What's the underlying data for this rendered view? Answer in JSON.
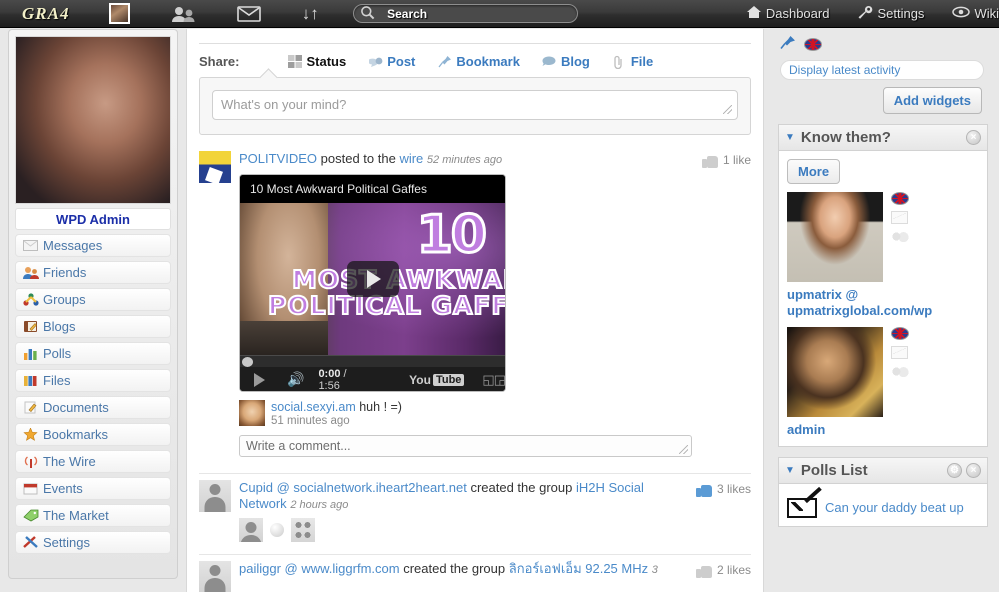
{
  "topbar": {
    "logo": "GRA4",
    "icons": [
      {
        "name": "user-avatar-icon",
        "label": "Profile"
      },
      {
        "name": "friends-icon",
        "label": "Friends"
      },
      {
        "name": "messages-icon",
        "label": "Messages"
      },
      {
        "name": "updates-icon",
        "label": "Updates"
      }
    ],
    "search": {
      "text": "Search",
      "placeholder": "Search"
    },
    "right_links": [
      {
        "name": "dashboard",
        "label": "Dashboard",
        "icon": "home-icon"
      },
      {
        "name": "settings",
        "label": "Settings",
        "icon": "wrench-icon"
      },
      {
        "name": "wiki",
        "label": "Wiki",
        "icon": "eye-icon"
      }
    ]
  },
  "sidebar": {
    "profile_name": "WPD Admin",
    "items": [
      {
        "label": "Messages",
        "icon": "envelope-icon"
      },
      {
        "label": "Friends",
        "icon": "friends-icon"
      },
      {
        "label": "Groups",
        "icon": "groups-icon"
      },
      {
        "label": "Blogs",
        "icon": "notebook-icon"
      },
      {
        "label": "Polls",
        "icon": "bar-chart-icon"
      },
      {
        "label": "Files",
        "icon": "folders-icon"
      },
      {
        "label": "Documents",
        "icon": "document-icon"
      },
      {
        "label": "Bookmarks",
        "icon": "star-icon"
      },
      {
        "label": "The Wire",
        "icon": "broadcast-icon"
      },
      {
        "label": "Events",
        "icon": "calendar-icon"
      },
      {
        "label": "The Market",
        "icon": "tag-icon"
      },
      {
        "label": "Settings",
        "icon": "tools-icon"
      }
    ]
  },
  "share": {
    "label": "Share:",
    "tabs": [
      {
        "label": "Status",
        "icon": "status-icon",
        "active": true
      },
      {
        "label": "Post",
        "icon": "post-icon",
        "active": false
      },
      {
        "label": "Bookmark",
        "icon": "pin-icon",
        "active": false
      },
      {
        "label": "Blog",
        "icon": "speech-bubble-icon",
        "active": false
      },
      {
        "label": "File",
        "icon": "paperclip-icon",
        "active": false
      }
    ],
    "input_placeholder": "What's on your mind?"
  },
  "feed": {
    "items": [
      {
        "author": "POLITVIDEO",
        "action": "posted to the",
        "target": "wire",
        "time": "52 minutes ago",
        "likes": "1 like",
        "like_color": "gray",
        "video": {
          "title": "10 Most Awkward Political Gaffes",
          "overlay_number": "10",
          "overlay_line1": "MOST AWKWARD",
          "overlay_line2": "POLITICAL GAFFES",
          "current_time": "0:00",
          "separator": "/",
          "duration": "1:56",
          "brand_you": "You",
          "brand_tube": "Tube"
        },
        "comment": {
          "author": "social.sexyi.am",
          "text": "huh ! =)",
          "time": "51 minutes ago"
        },
        "comment_placeholder": "Write a comment..."
      },
      {
        "author": "Cupid @ socialnetwork.iheart2heart.net",
        "action": "created the group",
        "target": "iH2H Social Network",
        "time": "2 hours ago",
        "likes": "3 likes",
        "like_color": "blue"
      },
      {
        "author": "pailiggr @ www.liggrfm.com",
        "action": "created the group",
        "target": "ลิกอร์เอฟเอ็ม 92.25 MHz",
        "time": "3",
        "likes": "2 likes",
        "like_color": "gray"
      }
    ]
  },
  "right": {
    "pin_icon": "pin-icon",
    "flag_icon": "uk-flag-icon",
    "activity_label": "Display latest activity",
    "add_widgets_label": "Add widgets",
    "widgets": [
      {
        "title": "Know them?",
        "caret": "▼",
        "close": "×",
        "more_label": "More",
        "people": [
          {
            "name": "upmatrix @ upmatrixglobal.com/wp"
          },
          {
            "name": "admin"
          }
        ]
      },
      {
        "title": "Polls List",
        "caret": "▼",
        "gear": "⚙",
        "close": "×",
        "poll_text": "Can your daddy beat up"
      }
    ]
  },
  "colors": {
    "link": "#4a8ac9",
    "accent": "#3b7bbf",
    "topbar": "#2e2e2e",
    "profile_name": "#1b2ea8"
  }
}
